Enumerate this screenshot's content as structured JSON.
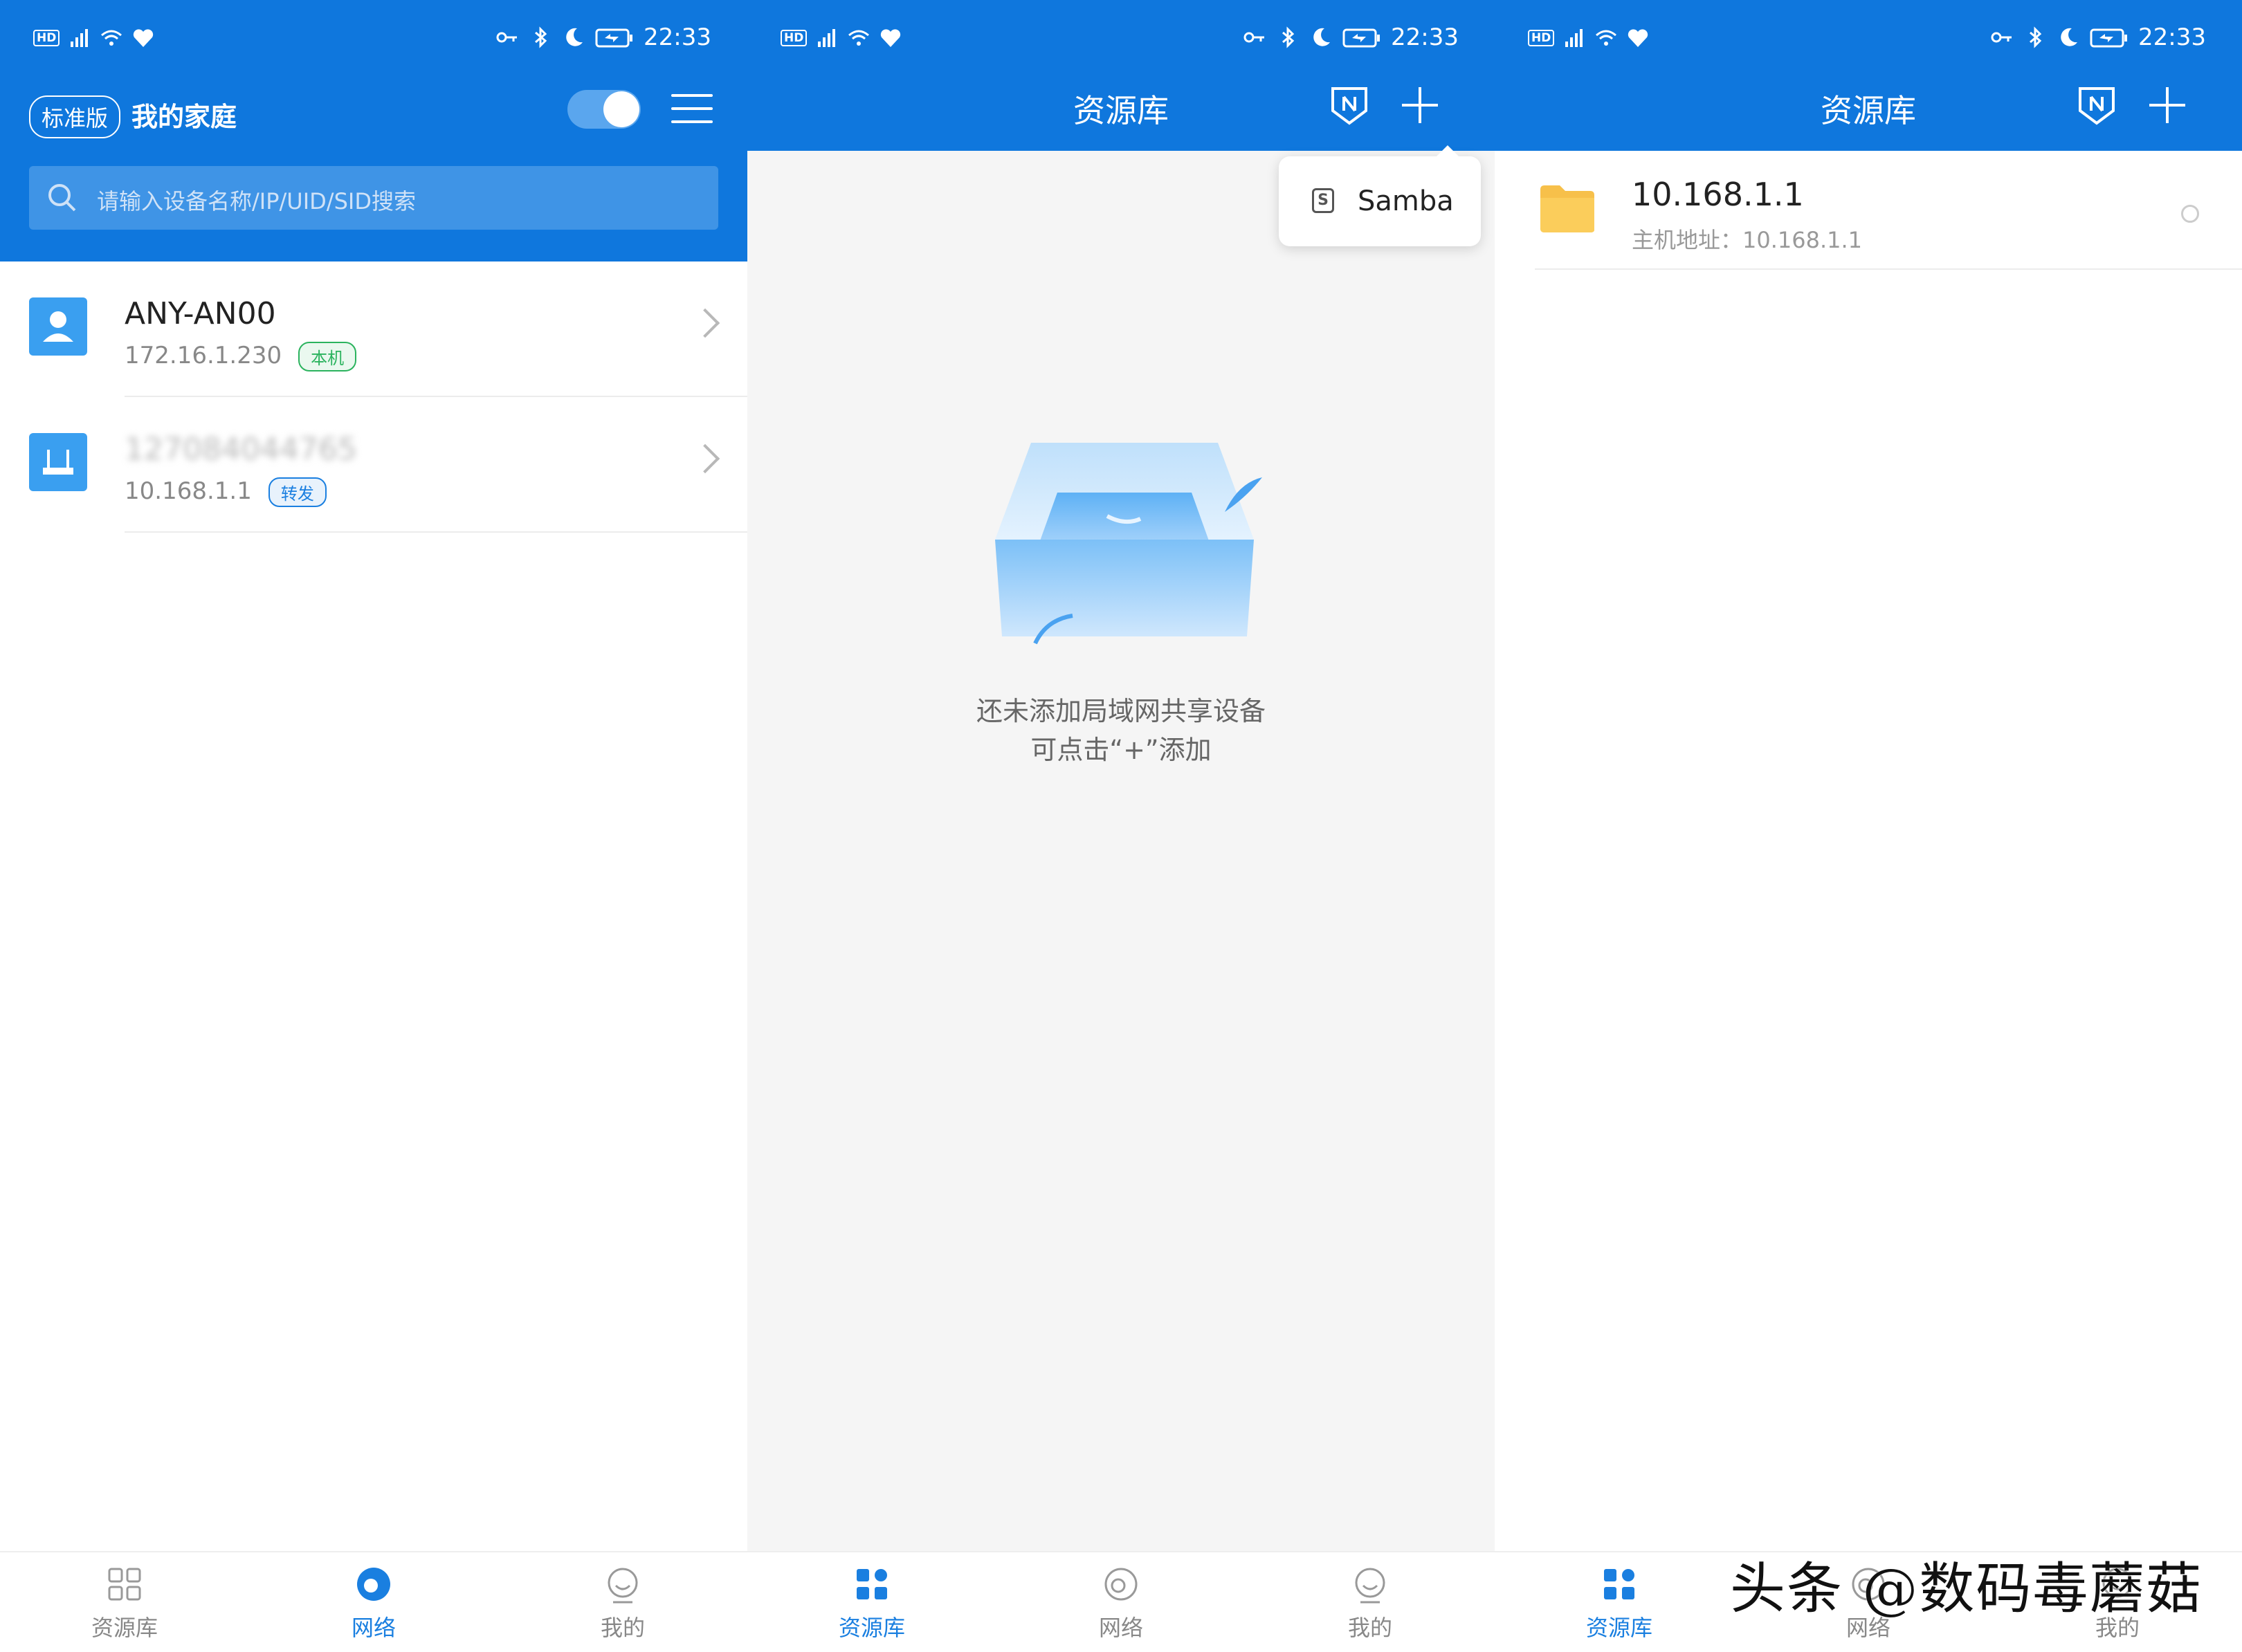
{
  "colors": {
    "primary": "#0f77dd",
    "accent": "#1a7fe0",
    "tag_green": "#2bb35e",
    "folder": "#f7c04a"
  },
  "status_bar": {
    "time": "22:33",
    "left_icons": [
      "hd-icon",
      "5g-signal-icon",
      "wifi-icon",
      "health-icon"
    ],
    "right_icons": [
      "key-icon",
      "bluetooth-icon",
      "moon-icon",
      "battery-charging-icon"
    ]
  },
  "screen1": {
    "edition_badge": "标准版",
    "title": "我的家庭",
    "search_placeholder": "请输入设备名称/IP/UID/SID搜索",
    "devices": [
      {
        "name": "ANY-AN00",
        "ip": "172.16.1.230",
        "tag": "本机",
        "icon": "person-icon"
      },
      {
        "name": "127084044765",
        "ip": "10.168.1.1",
        "tag": "转发",
        "icon": "router-icon"
      }
    ]
  },
  "screen2": {
    "title": "资源库",
    "popup_item": "Samba",
    "empty_line1": "还未添加局域网共享设备",
    "empty_line2": "可点击“+”添加"
  },
  "screen3": {
    "title": "资源库",
    "resource": {
      "name": "10.168.1.1",
      "subtitle": "主机地址：10.168.1.1"
    }
  },
  "tabs": [
    "资源库",
    "网络",
    "我的"
  ],
  "watermark": "头条 @数码毒蘑菇"
}
